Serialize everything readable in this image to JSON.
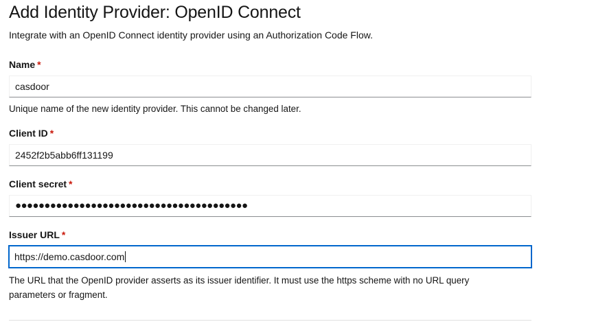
{
  "header": {
    "title": "Add Identity Provider: OpenID Connect",
    "subtitle": "Integrate with an OpenID Connect identity provider using an Authorization Code Flow."
  },
  "fields": {
    "name": {
      "label": "Name",
      "required_mark": "*",
      "value": "casdoor",
      "helper": "Unique name of the new identity provider. This cannot be changed later."
    },
    "client_id": {
      "label": "Client ID",
      "required_mark": "*",
      "value": "2452f2b5abb6ff131199"
    },
    "client_secret": {
      "label": "Client secret",
      "required_mark": "*",
      "masked_value": "●●●●●●●●●●●●●●●●●●●●●●●●●●●●●●●●●●●●●●●●"
    },
    "issuer_url": {
      "label": "Issuer URL",
      "required_mark": "*",
      "value": "https://demo.casdoor.com",
      "helper": "The URL that the OpenID provider asserts as its issuer identifier. It must use the https scheme with no URL query parameters or fragment."
    }
  },
  "colors": {
    "required": "#c9190b",
    "focus_border": "#0066cc",
    "text": "#151515"
  }
}
